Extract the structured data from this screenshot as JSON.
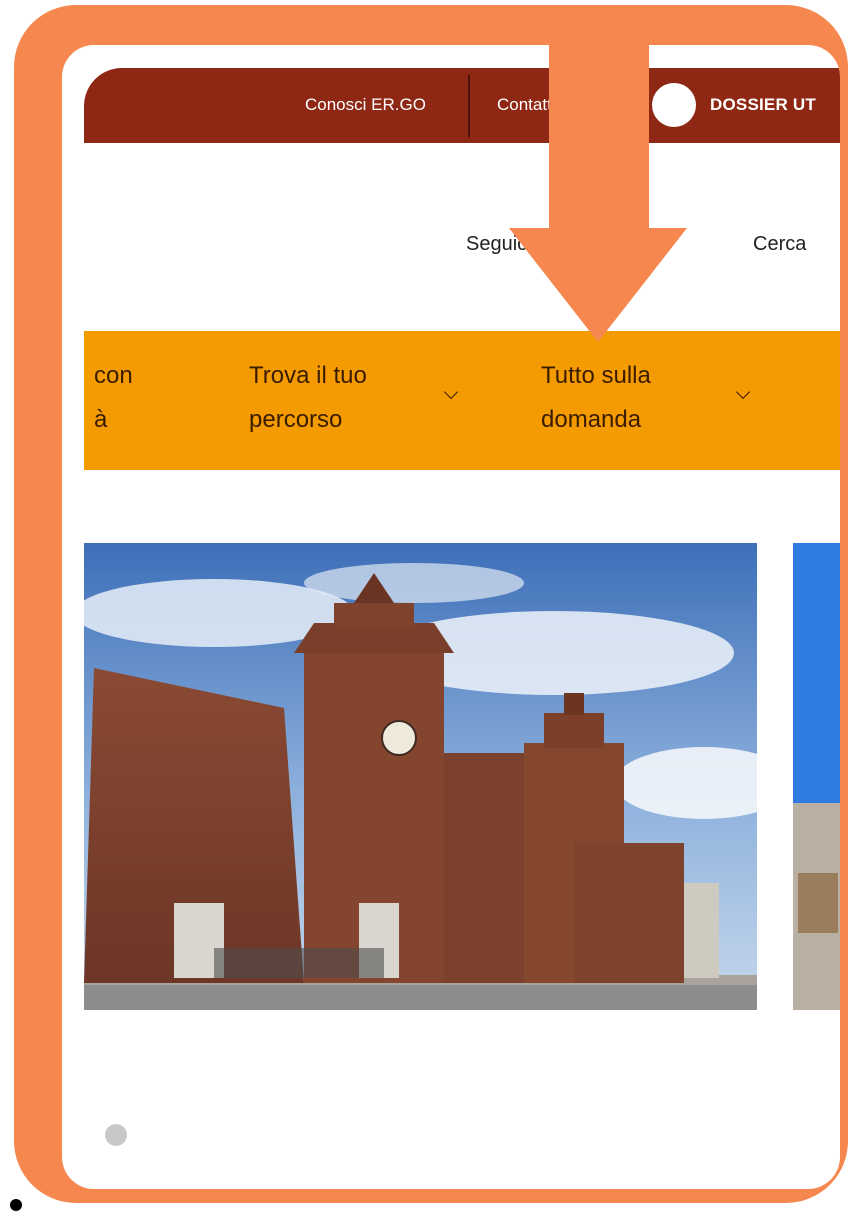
{
  "topbar": {
    "about_link": "Conosci ER.GO",
    "contacts_link": "Contatti",
    "dossier_label": "DOSSIER UT"
  },
  "header": {
    "follow_label": "Seguici",
    "search_label": "Cerca"
  },
  "menu": {
    "item_partial_line1": "con",
    "item_partial_line2": "à",
    "item_find_path_line1": "Trova il tuo",
    "item_find_path_line2": "percorso",
    "item_application_line1": "Tutto sulla",
    "item_application_line2": "domanda"
  },
  "slider": {
    "slide_subject": "castle-photo",
    "active_index": 1
  },
  "colors": {
    "frame": "#f5874f",
    "topbar": "#8e2814",
    "navbar": "#f39b00",
    "arrow": "#f5874f"
  },
  "icons": [
    "chevron-down-icon",
    "down-arrow-icon"
  ]
}
